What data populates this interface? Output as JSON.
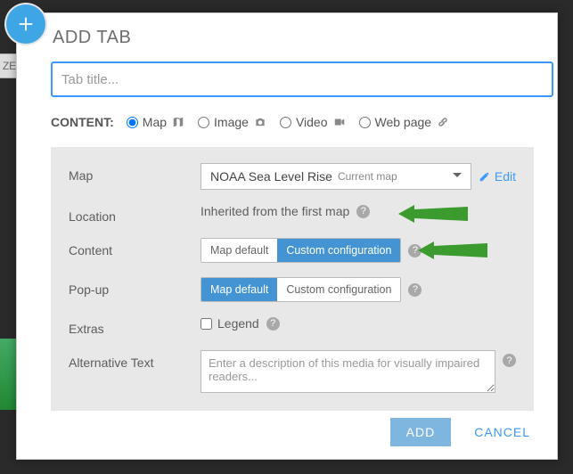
{
  "header": {
    "title": "ADD TAB"
  },
  "tab_input": {
    "placeholder": "Tab title..."
  },
  "content_type": {
    "label": "CONTENT:",
    "options": {
      "map": "Map",
      "image": "Image",
      "video": "Video",
      "webpage": "Web page"
    },
    "selected": "map"
  },
  "panel": {
    "map": {
      "label": "Map",
      "dropdown_main": "NOAA Sea Level Rise",
      "dropdown_sub": "Current map",
      "edit_label": "Edit"
    },
    "location": {
      "label": "Location",
      "value": "Inherited from the first map"
    },
    "content": {
      "label": "Content",
      "opt_default": "Map default",
      "opt_custom": "Custom configuration"
    },
    "popup": {
      "label": "Pop-up",
      "opt_default": "Map default",
      "opt_custom": "Custom configuration"
    },
    "extras": {
      "label": "Extras",
      "legend": "Legend"
    },
    "alttext": {
      "label": "Alternative Text",
      "placeholder": "Enter a description of this media for visually impaired readers..."
    }
  },
  "footer": {
    "add": "ADD",
    "cancel": "CANCEL"
  },
  "misc": {
    "ze": "ZE"
  }
}
